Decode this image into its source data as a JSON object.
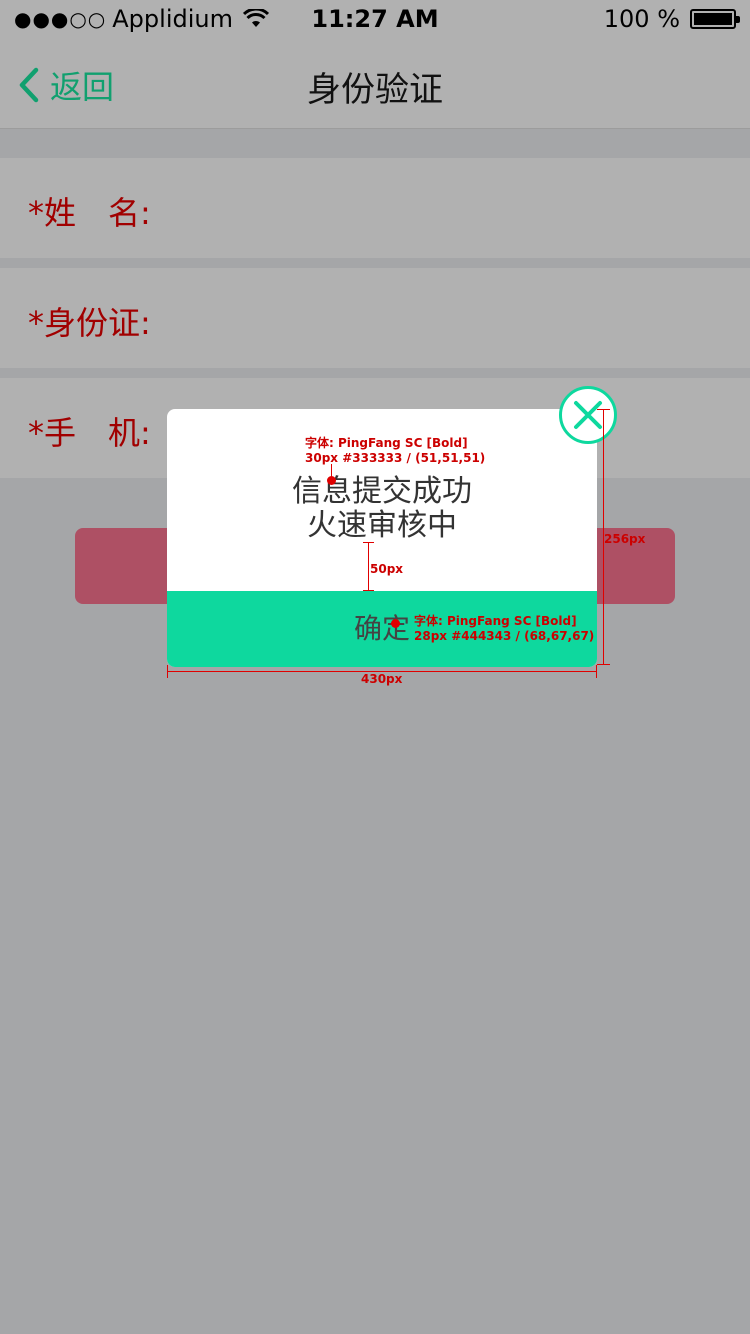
{
  "status_bar": {
    "signal_dots": "●●●○○",
    "carrier": "Applidium",
    "time": "11:27 AM",
    "battery": "100 %"
  },
  "nav": {
    "back_label": "返回",
    "title": "身份验证"
  },
  "form": {
    "name_label": "*姓　名:",
    "id_label": "*身份证:",
    "phone_label": "*手　机:"
  },
  "modal": {
    "message_line1": "信息提交成功",
    "message_line2": "火速审核中",
    "confirm_label": "确定"
  },
  "annotations": {
    "title_font_line1": "字体: PingFang SC [Bold]",
    "title_font_line2": "30px #333333 / (51,51,51)",
    "button_font_line1": "字体: PingFang SC [Bold]",
    "button_font_line2": "28px #444343 / (68,67,67)",
    "gap_label": "50px",
    "height_label": "256px",
    "width_label": "430px"
  },
  "colors": {
    "accent": "#0ed89e",
    "back_text": "#11a06f",
    "label_red": "#a10000",
    "submit_button": "#ae5064",
    "overlay_bg": "#a5a6a8",
    "annotation_red": "#e00000"
  },
  "icons": {
    "wifi": "wifi-icon",
    "battery": "battery-icon",
    "back": "chevron-left-icon",
    "close": "close-icon"
  }
}
